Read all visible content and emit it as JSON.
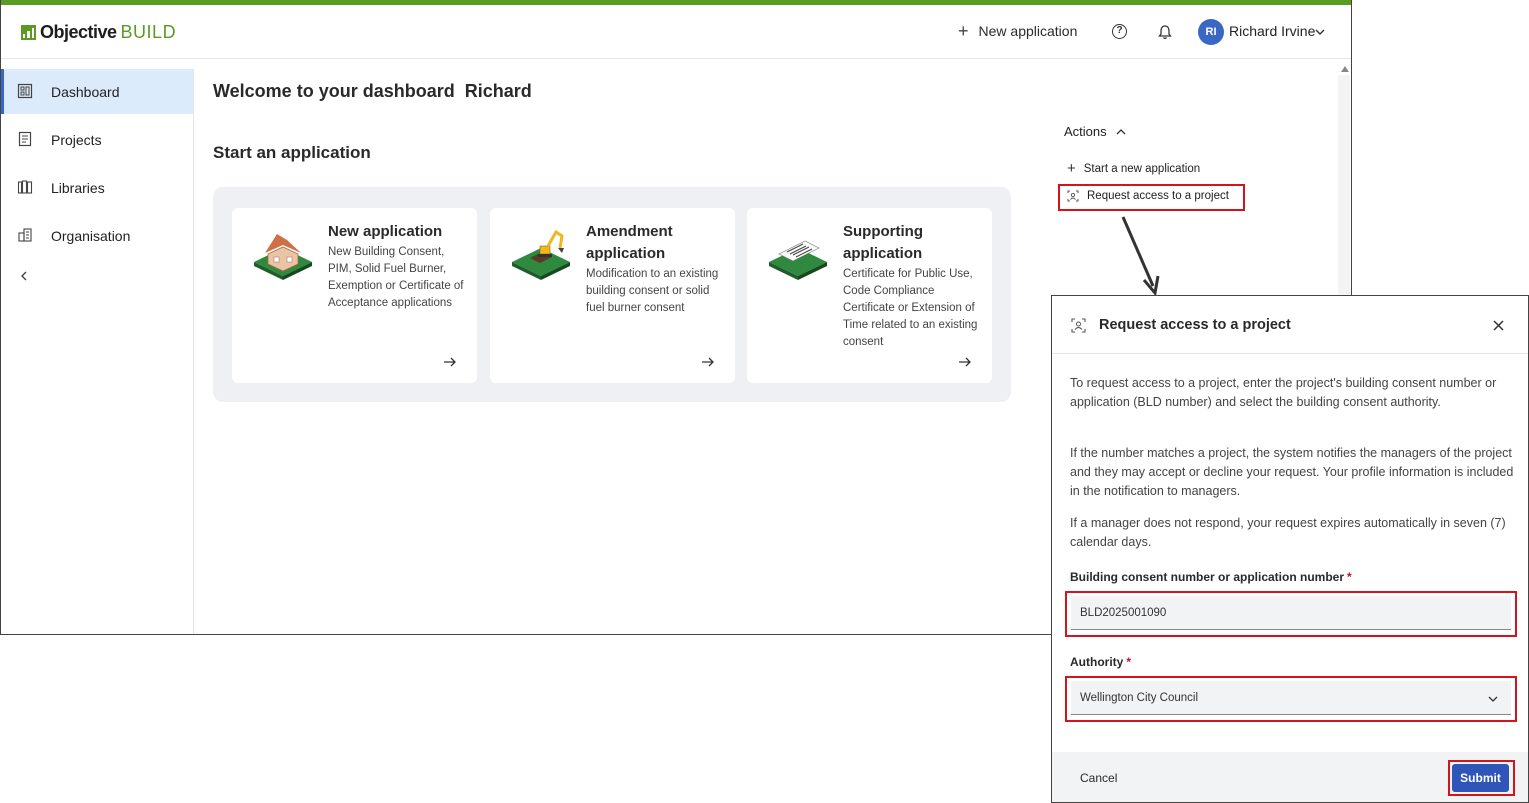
{
  "colors": {
    "brand_green": "#5b9a23",
    "accent_blue": "#3a66c4",
    "highlight_red": "#d3141b",
    "active_nav_bg": "#dcebfb"
  },
  "header": {
    "logo_part1": "Objective",
    "logo_part2": "BUILD",
    "new_application": "New application",
    "help_icon": "question-circle-icon",
    "notifications_icon": "bell-icon",
    "user_initials": "RI",
    "user_name": "Richard Irvine"
  },
  "sidebar": {
    "items": [
      {
        "label": "Dashboard",
        "icon": "dashboard-icon",
        "active": true
      },
      {
        "label": "Projects",
        "icon": "projects-icon",
        "active": false
      },
      {
        "label": "Libraries",
        "icon": "libraries-icon",
        "active": false
      },
      {
        "label": "Organisation",
        "icon": "organisation-icon",
        "active": false
      }
    ],
    "collapse_icon": "chevron-left-icon"
  },
  "main": {
    "welcome": "Welcome to your dashboard",
    "user_first_name": "Richard",
    "section_title": "Start an application",
    "cards": [
      {
        "title": "New application",
        "description": "New Building Consent, PIM, Solid Fuel Burner, Exemption or Certificate of Acceptance applications",
        "icon": "house-illustration"
      },
      {
        "title": "Amendment application",
        "description": "Modification to an existing building consent or solid fuel burner consent",
        "icon": "excavator-illustration"
      },
      {
        "title": "Supporting application",
        "description": "Certificate for Public Use, Code Compliance Certificate or Extension of Time related to an existing consent",
        "icon": "certificate-illustration"
      }
    ]
  },
  "actions": {
    "heading": "Actions",
    "items": [
      {
        "label": "Start a new application",
        "icon": "plus-icon"
      },
      {
        "label": "Request access to a project",
        "icon": "request-access-icon"
      }
    ]
  },
  "modal": {
    "title": "Request access to a project",
    "paragraphs": [
      "To request access to a project, enter the project's building consent number or application (BLD number) and select the building consent authority.",
      "If the number matches a project, the system notifies the managers of the project and they may accept or decline your request. Your profile information is included in the notification to managers.",
      "If a manager does not respond, your request expires automatically in seven (7) calendar days."
    ],
    "consent_label": "Building consent number or application number",
    "consent_value": "BLD2025001090",
    "authority_label": "Authority",
    "authority_value": "Wellington City Council",
    "required_mark": "*",
    "cancel": "Cancel",
    "submit": "Submit"
  }
}
